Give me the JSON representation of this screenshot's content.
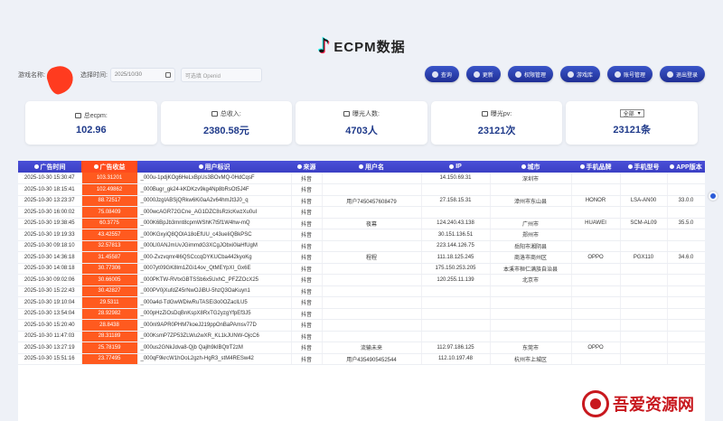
{
  "header": {
    "title": "ECPM数据"
  },
  "filters": {
    "game_label": "游戏名称:",
    "time_label": "选择时间:",
    "date_value": "2025/10/30",
    "openid_placeholder": "可选填 Openid"
  },
  "buttons": [
    {
      "label": "查询"
    },
    {
      "label": "更新"
    },
    {
      "label": "权限管理"
    },
    {
      "label": "游戏库"
    },
    {
      "label": "账号管理"
    },
    {
      "label": "退出登录"
    }
  ],
  "stats": {
    "ecpm": {
      "label": "总ecpm:",
      "value": "102.96"
    },
    "income": {
      "label": "总收入:",
      "value": "2380.58元"
    },
    "users": {
      "label": "曝光人数:",
      "value": "4703人"
    },
    "pv": {
      "label": "曝光pv:",
      "value": "23121次"
    },
    "all": {
      "select": "全部",
      "value": "23121条"
    }
  },
  "table": {
    "headers": [
      "广告时间",
      "广告收益",
      "用户标识",
      "来源",
      "用户名",
      "IP",
      "城市",
      "手机品牌",
      "手机型号",
      "APP版本"
    ],
    "rows": [
      [
        "2025-10-30 15:30:47",
        "103.31201",
        "_000u-1pdjKOg6HeLxBpUs3BOvMQ-0HdCqsF",
        "抖音",
        "",
        "14.150.69.31",
        "深圳市",
        "",
        "",
        ""
      ],
      [
        "2025-10-30 18:15:41",
        "102.49862",
        "_000Bugr_gk24-kKDKzv9kg4Np8bRsOt5J4F",
        "抖音",
        "",
        "",
        "",
        "",
        "",
        ""
      ],
      [
        "2025-10-30 13:23:37",
        "88.72517",
        "_0000JzgIABSjQRkw6Ki0aA2v64hmJt3J0_q",
        "抖音",
        "用户7450457608479",
        "27.158.15.31",
        "漳州市东山县",
        "HONOR",
        "LSA-AN00",
        "33.0.0"
      ],
      [
        "2025-10-30 16:00:02",
        "75.08409",
        "_000wcAGR72GCne_AG1DZC8sRzicKwzXu0uI",
        "抖音",
        "",
        "",
        "",
        "",
        "",
        ""
      ],
      [
        "2025-10-30 19:38:45",
        "60.3775",
        "_000K6BpJb3mnt8cpmWShK7t5f1W4hw-mQ",
        "抖音",
        "夜幕",
        "124.240.43.138",
        "广州市",
        "HUAWEI",
        "SCM-AL09",
        "35.5.0"
      ],
      [
        "2025-10-30 19:19:33",
        "43.42557",
        "_000KGxyiQ8QOlA18oEfUU_c43ueIiQBkPSC",
        "抖音",
        "",
        "30.151.136.51",
        "郑州市",
        "",
        "",
        ""
      ],
      [
        "2025-10-30 09:18:10",
        "32.57813",
        "_000LI0ANJmUvJGimmdG3XCgJObxi0laHfUgM",
        "抖音",
        "",
        "223.144.126.75",
        "岳阳市湘阴县",
        "",
        "",
        ""
      ],
      [
        "2025-10-30 14:36:18",
        "31.45587",
        "_000-Zvzvqmr4l6QSCccqDYKUCba442kyoKg",
        "抖音",
        "程程",
        "111.18.125.245",
        "商洛市商州区",
        "OPPO",
        "PGX110",
        "34.6.0"
      ],
      [
        "2025-10-30 14:08:18",
        "30.77306",
        "_0007yt09GK8lm1ZGi14ov_QtMEYpXI_Gx6E",
        "抖音",
        "",
        "175.150.253.205",
        "本溪市桓仁满族自治县",
        "",
        "",
        ""
      ],
      [
        "2025-10-30 09:02:06",
        "30.66005",
        "_000PKTW-RVtxGBTSSb6x5UxhC_PFZZOcX25",
        "抖音",
        "",
        "120.255.11.139",
        "北京市",
        "",
        "",
        ""
      ],
      [
        "2025-10-30 15:22:43",
        "30.42827",
        "_000PV0jXufdZ45rNwOJiBU-5hzQ3OaKuyn1",
        "抖音",
        "",
        "",
        "",
        "",
        "",
        ""
      ],
      [
        "2025-10-30 19:10:04",
        "29.5311",
        "_000a4d-TdGwWDiwRuTASEi3o0OZaclLU5",
        "抖音",
        "",
        "",
        "",
        "",
        "",
        ""
      ],
      [
        "2025-10-30 13:54:04",
        "28.92982",
        "_000pHzZiOsDqBnKspX8RxTG2yzgYfpEf3J5",
        "抖音",
        "",
        "",
        "",
        "",
        "",
        ""
      ],
      [
        "2025-10-30 15:20:40",
        "28.8438",
        "_000nI9APR0PHM7koeJ219ppOnBaPAmsv77D",
        "抖音",
        "",
        "",
        "",
        "",
        "",
        ""
      ],
      [
        "2025-10-30 11:47:03",
        "28.31189",
        "_000KsmP7ZP53ZLWu2wXR_KL1kJUNW-OjcC6",
        "抖音",
        "",
        "",
        "",
        "",
        "",
        ""
      ],
      [
        "2025-10-30 13:27:19",
        "25.78159",
        "_000us2GNkJdva8-Qjb Qajlh9kIBQtrT2zM",
        "抖音",
        "流输未来",
        "112.97.186.125",
        "东莞市",
        "OPPO",
        "",
        ""
      ],
      [
        "2025-10-30 15:51:16",
        "23.77495",
        "_000qF9krcW1hOoL2gzh-HgR3_stM4RESw42",
        "抖音",
        "用户4354905452544",
        "112.10.197.48",
        "杭州市上城区",
        "",
        "",
        ""
      ]
    ]
  },
  "watermark": {
    "text": "吾爱资源网"
  }
}
